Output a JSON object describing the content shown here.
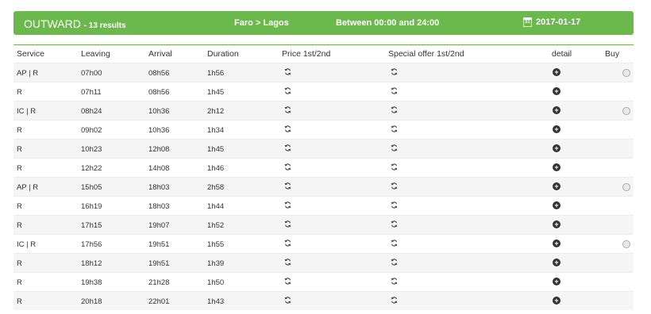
{
  "header": {
    "direction": "OUTWARD",
    "results": "- 13 results",
    "route": "Faro > Lagos",
    "time_range": "Between 00:00 and 24:00",
    "date": "2017-01-17",
    "date_icon": "calendar-icon",
    "background": "#6bb84c"
  },
  "columns": {
    "service": "Service",
    "leaving": "Leaving",
    "arrival": "Arrival",
    "duration": "Duration",
    "price": "Price 1st/2nd",
    "special": "Special offer 1st/2nd",
    "detail": "detail",
    "buy": "Buy"
  },
  "icons": {
    "price": "refresh-icon",
    "special": "refresh-icon",
    "detail": "plus-circle-icon",
    "buy": "radio-button"
  },
  "rows": [
    {
      "service": "AP | R",
      "leaving": "07h00",
      "arrival": "08h56",
      "duration": "1h56",
      "buy": true
    },
    {
      "service": "R",
      "leaving": "07h11",
      "arrival": "08h56",
      "duration": "1h45",
      "buy": false
    },
    {
      "service": "IC | R",
      "leaving": "08h24",
      "arrival": "10h36",
      "duration": "2h12",
      "buy": true
    },
    {
      "service": "R",
      "leaving": "09h02",
      "arrival": "10h36",
      "duration": "1h34",
      "buy": false
    },
    {
      "service": "R",
      "leaving": "10h23",
      "arrival": "12h08",
      "duration": "1h45",
      "buy": false
    },
    {
      "service": "R",
      "leaving": "12h22",
      "arrival": "14h08",
      "duration": "1h46",
      "buy": false
    },
    {
      "service": "AP | R",
      "leaving": "15h05",
      "arrival": "18h03",
      "duration": "2h58",
      "buy": true
    },
    {
      "service": "R",
      "leaving": "16h19",
      "arrival": "18h03",
      "duration": "1h44",
      "buy": false
    },
    {
      "service": "R",
      "leaving": "17h15",
      "arrival": "19h07",
      "duration": "1h52",
      "buy": false
    },
    {
      "service": "IC | R",
      "leaving": "17h56",
      "arrival": "19h51",
      "duration": "1h55",
      "buy": true
    },
    {
      "service": "R",
      "leaving": "18h12",
      "arrival": "19h51",
      "duration": "1h39",
      "buy": false
    },
    {
      "service": "R",
      "leaving": "19h38",
      "arrival": "21h28",
      "duration": "1h50",
      "buy": false
    },
    {
      "service": "R",
      "leaving": "20h18",
      "arrival": "22h01",
      "duration": "1h43",
      "buy": false
    }
  ]
}
